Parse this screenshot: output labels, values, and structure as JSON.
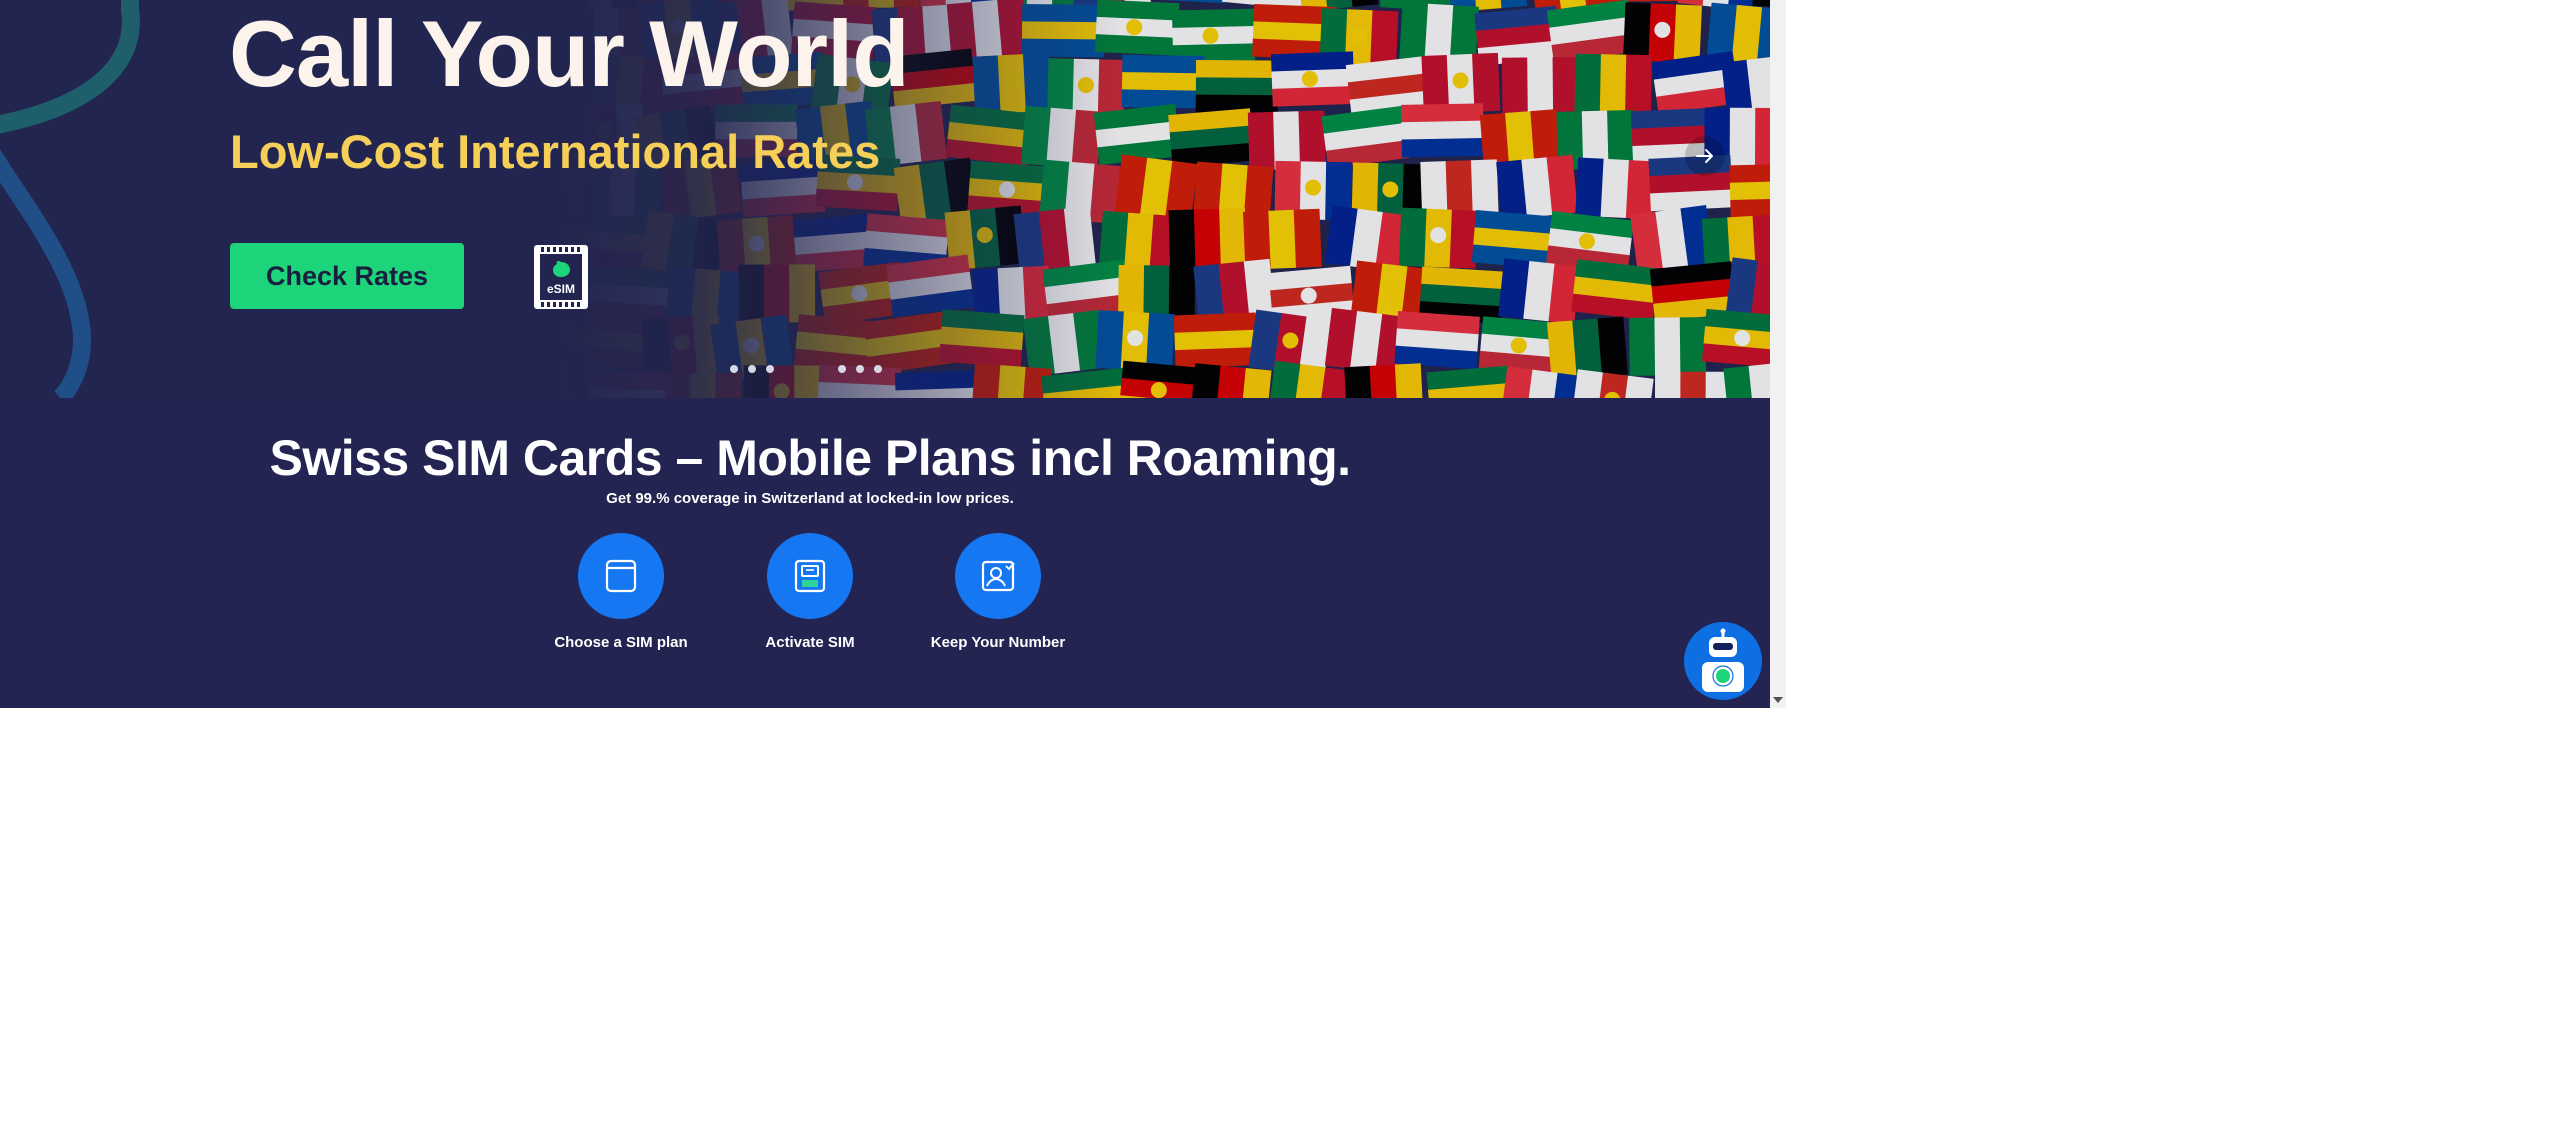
{
  "hero": {
    "title": "Call Your World",
    "subtitle": "Low-Cost International Rates",
    "cta_label": "Check Rates",
    "esim_label": "eSIM",
    "slide_dots_group1": 3,
    "slide_dots_group2": 3,
    "next_icon": "arrow-right-icon"
  },
  "section": {
    "title": "Swiss SIM Cards – Mobile Plans incl Roaming.",
    "subtitle": "Get 99.% coverage in Switzerland at locked-in low prices.",
    "features": [
      {
        "label": "Choose a SIM plan",
        "icon": "sim-card-icon"
      },
      {
        "label": "Activate SIM",
        "icon": "activate-sim-icon"
      },
      {
        "label": "Keep Your Number",
        "icon": "keep-number-icon"
      }
    ]
  },
  "chat": {
    "icon": "robot-icon"
  },
  "colors": {
    "background": "#232452",
    "accent_green": "#1ed47b",
    "accent_yellow": "#f6cf58",
    "icon_blue": "#1677f2"
  }
}
